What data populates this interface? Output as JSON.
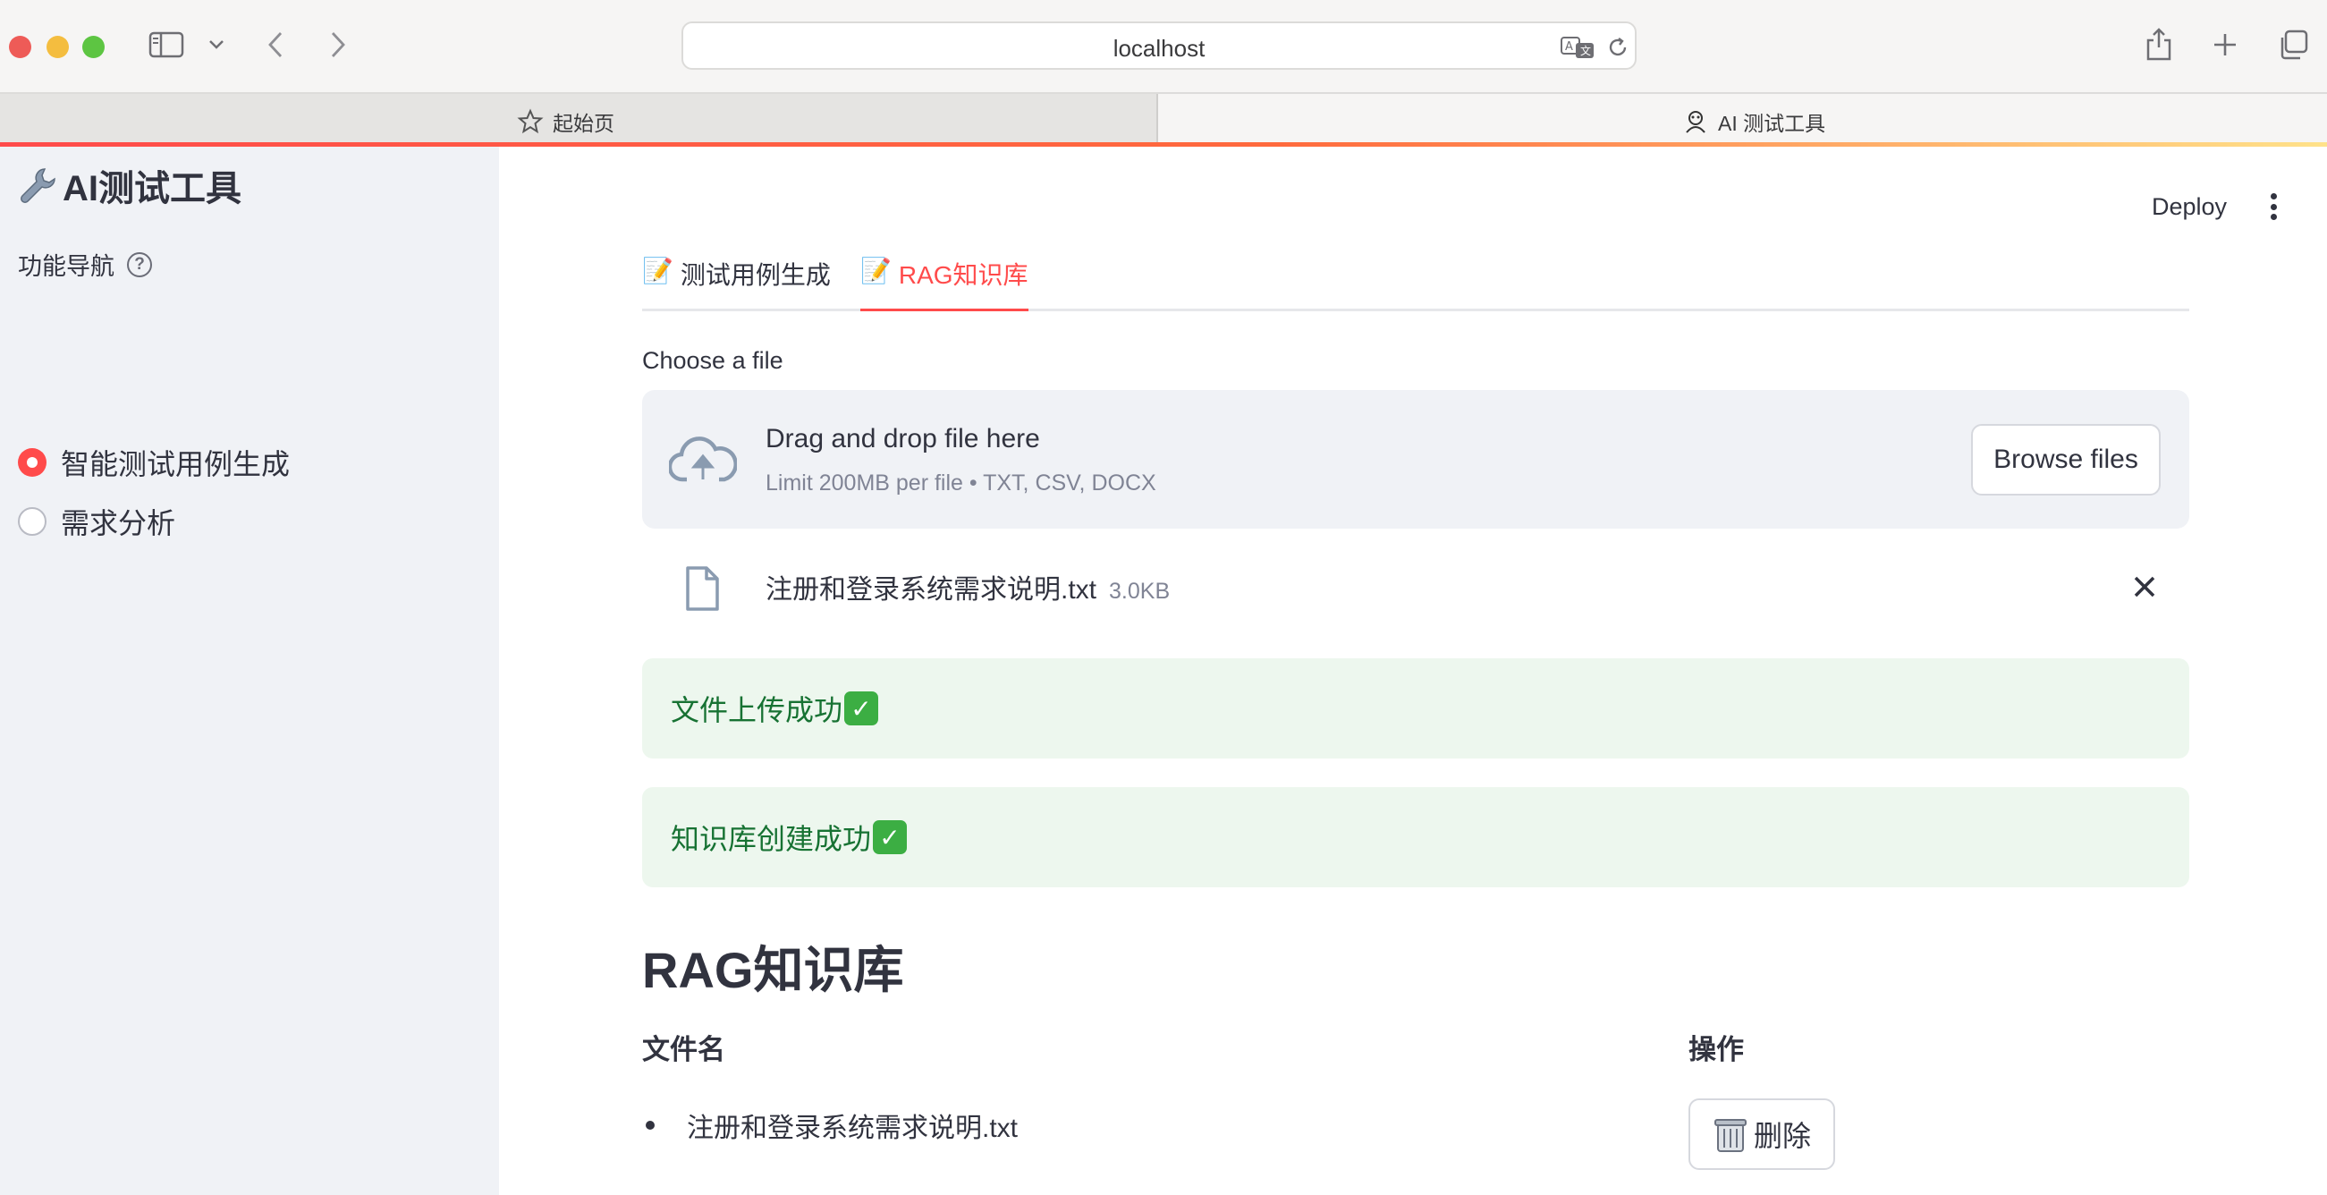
{
  "browser": {
    "url": "localhost",
    "tabs": [
      {
        "label": "起始页",
        "active": false
      },
      {
        "label": "AI 测试工具",
        "active": true
      }
    ]
  },
  "sidebar": {
    "app_title": "AI测试工具",
    "title_icon": "wrench-icon",
    "nav_label": "功能导航",
    "help_icon": "?",
    "options": [
      {
        "label": "智能测试用例生成",
        "selected": true
      },
      {
        "label": "需求分析",
        "selected": false
      }
    ]
  },
  "header": {
    "deploy_label": "Deploy"
  },
  "main": {
    "tabs": [
      {
        "label": "测试用例生成",
        "icon": "memo-icon",
        "active": false
      },
      {
        "label": "RAG知识库",
        "icon": "memo-icon",
        "active": true
      }
    ],
    "uploader": {
      "label": "Choose a file",
      "drop_title": "Drag and drop file here",
      "drop_subtitle": "Limit 200MB per file • TXT, CSV, DOCX",
      "browse_label": "Browse files"
    },
    "uploaded_file": {
      "name": "注册和登录系统需求说明.txt",
      "size": "3.0KB"
    },
    "alerts": [
      {
        "text": "文件上传成功",
        "icon": "check-mark-icon"
      },
      {
        "text": "知识库创建成功",
        "icon": "check-mark-icon"
      }
    ],
    "knowledge_base": {
      "title": "RAG知识库",
      "columns": [
        "文件名",
        "操作"
      ],
      "rows": [
        {
          "file": "注册和登录系统需求说明.txt",
          "action_label": "删除",
          "action_icon": "trash-icon"
        }
      ]
    }
  },
  "colors": {
    "accent": "#ff4b4b",
    "sidebar_bg": "#f0f2f6",
    "success_bg": "#edf7ee",
    "success_text": "#177233"
  }
}
